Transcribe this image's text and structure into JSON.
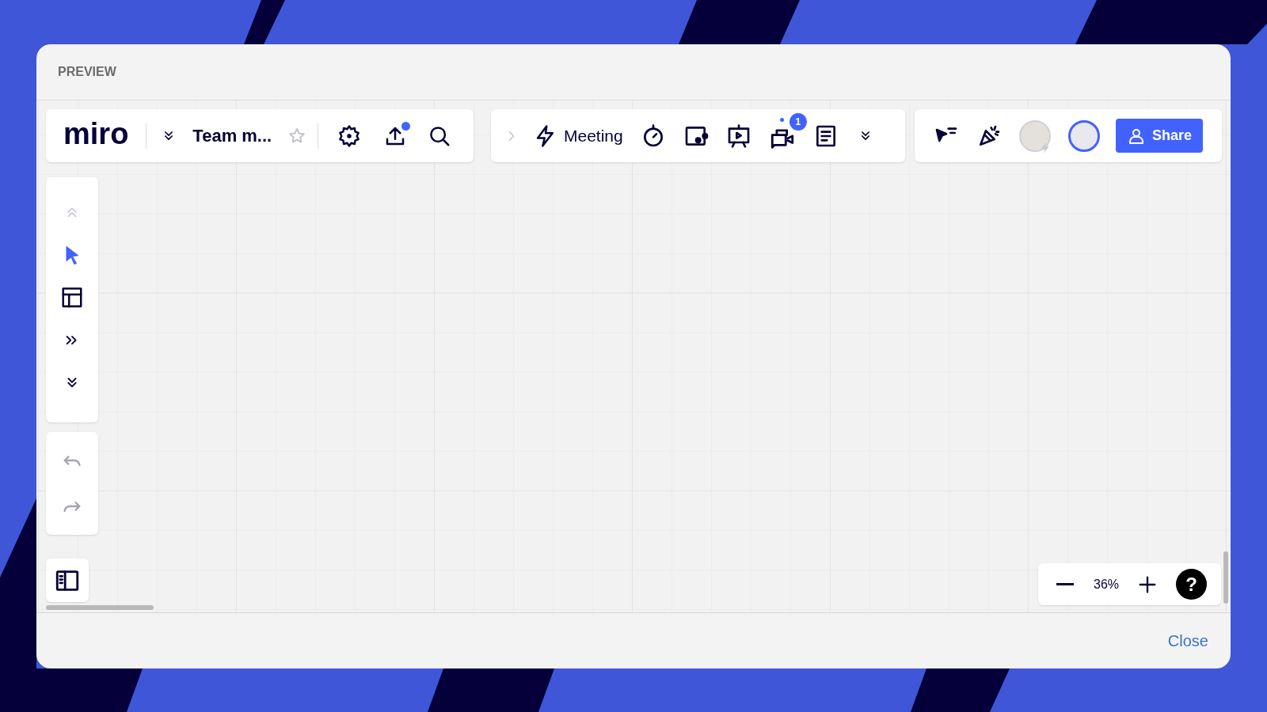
{
  "dialog": {
    "title": "PREVIEW",
    "close_label": "Close"
  },
  "board_toolbar": {
    "logo": "miro",
    "board_name": "Team m...",
    "starred": false,
    "export_notification": true
  },
  "meeting_toolbar": {
    "collapse_disabled": true,
    "meeting_label": "Meeting",
    "video_badge": "1"
  },
  "collab_toolbar": {
    "share_label": "Share"
  },
  "tools": [
    {
      "kind": "collapse",
      "disabled": true,
      "selected": false
    },
    {
      "kind": "select",
      "disabled": false,
      "selected": true
    },
    {
      "kind": "templates",
      "disabled": false,
      "selected": false
    },
    {
      "kind": "more",
      "disabled": false,
      "selected": false
    },
    {
      "kind": "expand",
      "disabled": false,
      "selected": false
    }
  ],
  "history": [
    {
      "kind": "undo",
      "disabled": true
    },
    {
      "kind": "redo",
      "disabled": true
    }
  ],
  "zoom": {
    "value": "36%",
    "help": "?"
  }
}
